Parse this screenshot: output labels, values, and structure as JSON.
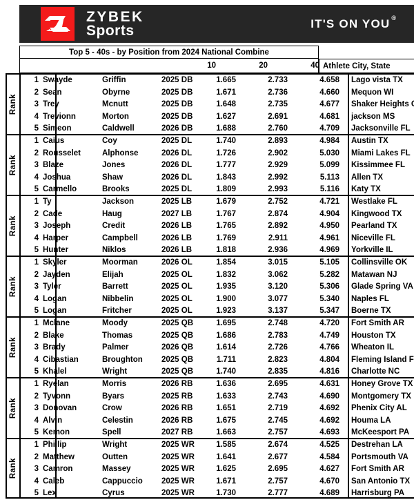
{
  "brand": {
    "logo_icon": "zybek-z-logo-icon",
    "name_line1": "ZYBEK",
    "name_line2": "Sports",
    "tagline": "IT'S ON YOU",
    "registered_mark": "®",
    "logo_red": "#f41b1b",
    "banner_dark": "#262626"
  },
  "table": {
    "title": "Top 5 -  40s - by Position from 2024 National Combine",
    "rank_axis_label": "Rank",
    "columns": {
      "rank": "Rank",
      "first_name": "",
      "last_name": "",
      "class_position": "",
      "split_10": "10",
      "split_20": "20",
      "split_40": "40",
      "city_state": "Athlete City, State"
    },
    "sections": [
      {
        "position": "DB",
        "rows": [
          {
            "rank": "1",
            "first": "Swayde",
            "last": "Griffin",
            "pos": "2025 DB",
            "t10": "1.665",
            "t20": "2.733",
            "t40": "4.658",
            "city": "Lago vista  TX"
          },
          {
            "rank": "2",
            "first": "Sean",
            "last": "Obyrne",
            "pos": "2025 DB",
            "t10": "1.671",
            "t20": "2.736",
            "t40": "4.660",
            "city": "Mequon  WI"
          },
          {
            "rank": "3",
            "first": "Trey",
            "last": "Mcnutt",
            "pos": "2025 DB",
            "t10": "1.648",
            "t20": "2.735",
            "t40": "4.677",
            "city": "Shaker Heights OH"
          },
          {
            "rank": "4",
            "first": "Trevionn",
            "last": "Morton",
            "pos": "2025 DB",
            "t10": "1.627",
            "t20": "2.691",
            "t40": "4.681",
            "city": "jackson MS"
          },
          {
            "rank": "5",
            "first": "Simeon",
            "last": "Caldwell",
            "pos": "2026 DB",
            "t10": "1.688",
            "t20": "2.760",
            "t40": "4.709",
            "city": "Jacksonville FL"
          }
        ]
      },
      {
        "position": "DL",
        "rows": [
          {
            "rank": "1",
            "first": "Caius",
            "last": "Coy",
            "pos": "2025 DL",
            "t10": "1.740",
            "t20": "2.893",
            "t40": "4.984",
            "city": "Austin TX"
          },
          {
            "rank": "2",
            "first": "Rousselet",
            "last": "Alphonse",
            "pos": "2026 DL",
            "t10": "1.726",
            "t20": "2.902",
            "t40": "5.030",
            "city": "Miami Lakes FL"
          },
          {
            "rank": "3",
            "first": "Blaze",
            "last": "Jones",
            "pos": "2026 DL",
            "t10": "1.777",
            "t20": "2.929",
            "t40": "5.099",
            "city": "Kissimmee FL"
          },
          {
            "rank": "4",
            "first": "Joshua",
            "last": "Shaw",
            "pos": "2026 DL",
            "t10": "1.843",
            "t20": "2.992",
            "t40": "5.113",
            "city": "Allen TX"
          },
          {
            "rank": "5",
            "first": "Carmello",
            "last": "Brooks",
            "pos": "2025 DL",
            "t10": "1.809",
            "t20": "2.993",
            "t40": "5.116",
            "city": "Katy TX"
          }
        ]
      },
      {
        "position": "LB",
        "rows": [
          {
            "rank": "1",
            "first": "Ty",
            "last": "Jackson",
            "pos": "2025 LB",
            "t10": "1.679",
            "t20": "2.752",
            "t40": "4.721",
            "city": "Westlake FL"
          },
          {
            "rank": "2",
            "first": "Cade",
            "last": "Haug",
            "pos": "2027 LB",
            "t10": "1.767",
            "t20": "2.874",
            "t40": "4.904",
            "city": "Kingwood TX"
          },
          {
            "rank": "3",
            "first": "Joseph",
            "last": "Credit",
            "pos": "2026 LB",
            "t10": "1.765",
            "t20": "2.892",
            "t40": "4.950",
            "city": "Pearland  TX"
          },
          {
            "rank": "4",
            "first": "Harper",
            "last": "Campbell",
            "pos": "2026 LB",
            "t10": "1.769",
            "t20": "2.911",
            "t40": "4.961",
            "city": "Niceville FL"
          },
          {
            "rank": "5",
            "first": "Hunter",
            "last": "Niklos",
            "pos": "2026 LB",
            "t10": "1.818",
            "t20": "2.936",
            "t40": "4.969",
            "city": "Yorkville IL"
          }
        ]
      },
      {
        "position": "OL",
        "rows": [
          {
            "rank": "1",
            "first": "Skyler",
            "last": "Moorman",
            "pos": "2026 OL",
            "t10": "1.854",
            "t20": "3.015",
            "t40": "5.105",
            "city": "Collinsville OK"
          },
          {
            "rank": "2",
            "first": "Jayden",
            "last": "Elijah",
            "pos": "2025 OL",
            "t10": "1.832",
            "t20": "3.062",
            "t40": "5.282",
            "city": "Matawan NJ"
          },
          {
            "rank": "3",
            "first": "Tyler",
            "last": "Barrett",
            "pos": "2025 OL",
            "t10": "1.935",
            "t20": "3.120",
            "t40": "5.306",
            "city": "Glade Spring VA"
          },
          {
            "rank": "4",
            "first": "Logan",
            "last": "Nibbelin",
            "pos": "2025 OL",
            "t10": "1.900",
            "t20": "3.077",
            "t40": "5.340",
            "city": "Naples FL"
          },
          {
            "rank": "5",
            "first": "Logan",
            "last": "Fritcher",
            "pos": "2025 OL",
            "t10": "1.923",
            "t20": "3.137",
            "t40": "5.347",
            "city": "Boerne TX"
          }
        ]
      },
      {
        "position": "QB",
        "rows": [
          {
            "rank": "1",
            "first": "Mclane",
            "last": "Moody",
            "pos": "2025 QB",
            "t10": "1.695",
            "t20": "2.748",
            "t40": "4.720",
            "city": "Fort Smith AR"
          },
          {
            "rank": "2",
            "first": "Blake",
            "last": "Thomas",
            "pos": "2025 QB",
            "t10": "1.686",
            "t20": "2.783",
            "t40": "4.749",
            "city": "Houston TX"
          },
          {
            "rank": "3",
            "first": "Brady",
            "last": "Palmer",
            "pos": "2026 QB",
            "t10": "1.614",
            "t20": "2.726",
            "t40": "4.766",
            "city": "Wheaton IL"
          },
          {
            "rank": "4",
            "first": "Cibastian",
            "last": "Broughton",
            "pos": "2025 QB",
            "t10": "1.711",
            "t20": "2.823",
            "t40": "4.804",
            "city": "Fleming Island FL"
          },
          {
            "rank": "5",
            "first": "Khalel",
            "last": "Wright",
            "pos": "2025 QB",
            "t10": "1.740",
            "t20": "2.835",
            "t40": "4.816",
            "city": "Charlotte NC"
          }
        ]
      },
      {
        "position": "RB",
        "rows": [
          {
            "rank": "1",
            "first": "Ryelan",
            "last": "Morris",
            "pos": "2026 RB",
            "t10": "1.636",
            "t20": "2.695",
            "t40": "4.631",
            "city": "Honey Grove  TX"
          },
          {
            "rank": "2",
            "first": "Tyvonn",
            "last": "Byars",
            "pos": "2025 RB",
            "t10": "1.633",
            "t20": "2.743",
            "t40": "4.690",
            "city": "Montgomery  TX"
          },
          {
            "rank": "3",
            "first": "Donovan",
            "last": "Crow",
            "pos": "2026 RB",
            "t10": "1.651",
            "t20": "2.719",
            "t40": "4.692",
            "city": "Phenix City AL"
          },
          {
            "rank": "4",
            "first": "Alvin",
            "last": "Celestin",
            "pos": "2026 RB",
            "t10": "1.675",
            "t20": "2.745",
            "t40": "4.692",
            "city": "Houma LA"
          },
          {
            "rank": "5",
            "first": "Kemon",
            "last": "Spell",
            "pos": "2027 RB",
            "t10": "1.663",
            "t20": "2.757",
            "t40": "4.693",
            "city": "McKeesport  PA"
          }
        ]
      },
      {
        "position": "WR",
        "rows": [
          {
            "rank": "1",
            "first": "Phillip",
            "last": "Wright",
            "pos": "2025 WR",
            "t10": "1.585",
            "t20": "2.674",
            "t40": "4.525",
            "city": "Destrehan LA"
          },
          {
            "rank": "2",
            "first": "Matthew",
            "last": "Outten",
            "pos": "2025 WR",
            "t10": "1.641",
            "t20": "2.677",
            "t40": "4.584",
            "city": "Portsmouth VA"
          },
          {
            "rank": "3",
            "first": "Camron",
            "last": "Massey",
            "pos": "2025 WR",
            "t10": "1.625",
            "t20": "2.695",
            "t40": "4.627",
            "city": "Fort Smith AR"
          },
          {
            "rank": "4",
            "first": "Caleb",
            "last": "Cappuccio",
            "pos": "2025 WR",
            "t10": "1.671",
            "t20": "2.757",
            "t40": "4.670",
            "city": "San Antonio TX"
          },
          {
            "rank": "5",
            "first": "Lex",
            "last": "Cyrus",
            "pos": "2025 WR",
            "t10": "1.730",
            "t20": "2.777",
            "t40": "4.689",
            "city": "Harrisburg PA"
          }
        ]
      }
    ]
  }
}
